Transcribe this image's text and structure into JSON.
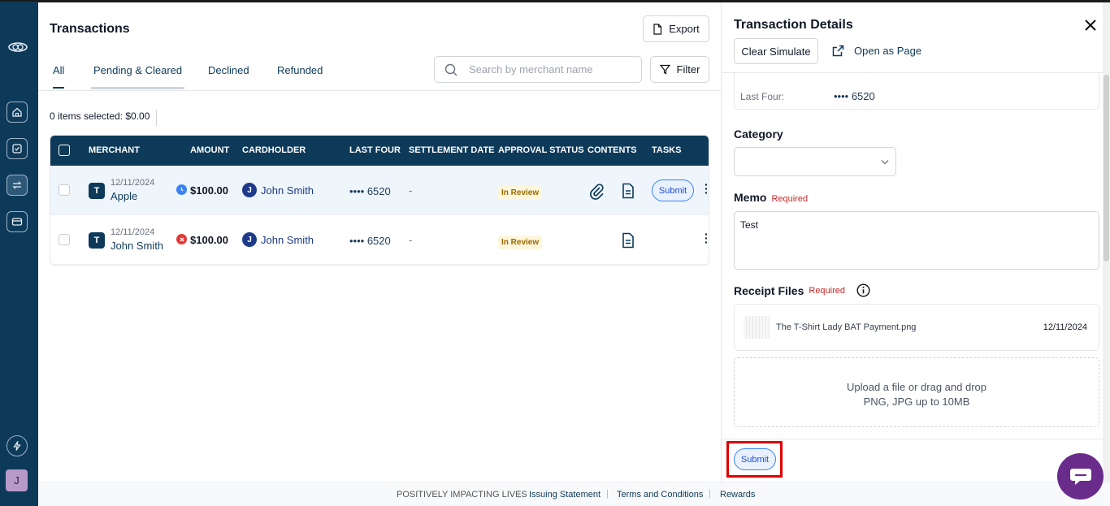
{
  "header": {
    "title": "Transactions",
    "export_label": "Export",
    "filter_label": "Filter",
    "search_placeholder": "Search by merchant name"
  },
  "tabs": [
    {
      "label": "All",
      "active": true
    },
    {
      "label": "Pending & Cleared"
    },
    {
      "label": "Declined"
    },
    {
      "label": "Refunded"
    }
  ],
  "selection": {
    "text": "0 items selected: $0.00"
  },
  "table": {
    "columns": [
      "MERCHANT",
      "AMOUNT",
      "CARDHOLDER",
      "LAST FOUR",
      "SETTLEMENT DATE",
      "APPROVAL STATUS",
      "CONTENTS",
      "TASKS"
    ],
    "rows": [
      {
        "merchant_initial": "T",
        "date": "12/11/2024",
        "merchant": "Apple",
        "amount": "$100.00",
        "amount_status": "pending",
        "cardholder_initial": "J",
        "cardholder": "John Smith",
        "last_four": "•••• 6520",
        "settlement": "-",
        "status": "In Review",
        "task": "Submit"
      },
      {
        "merchant_initial": "T",
        "date": "12/11/2024",
        "merchant": "John Smith",
        "amount": "$100.00",
        "amount_status": "declined",
        "cardholder_initial": "J",
        "cardholder": "John Smith",
        "last_four": "•••• 6520",
        "settlement": "-",
        "status": "In Review",
        "task": ""
      }
    ]
  },
  "panel": {
    "title": "Transaction Details",
    "clear_simulate": "Clear Simulate",
    "open_as_page": "Open as Page",
    "last_four_label": "Last Four:",
    "last_four_value": "•••• 6520",
    "category_label": "Category",
    "memo_label": "Memo",
    "memo_required": "Required",
    "memo_value": "Test",
    "receipt_label": "Receipt Files",
    "receipt_required": "Required",
    "file_name": "The T-Shirt Lady BAT Payment.png",
    "file_date": "12/11/2024",
    "upload_line1": "Upload a file or drag and drop",
    "upload_line2": "PNG, JPG up to 10MB",
    "submit_label": "Submit"
  },
  "footer": {
    "tagline": "POSITIVELY IMPACTING LIVES",
    "links": [
      "Issuing Statement",
      "Terms and Conditions",
      "Rewards"
    ]
  },
  "user": {
    "avatar_initial": "J"
  },
  "colors": {
    "brand": "#0e3a5a",
    "accent": "#3b82f6",
    "chat": "#6a2c8a",
    "danger": "#e00000"
  }
}
